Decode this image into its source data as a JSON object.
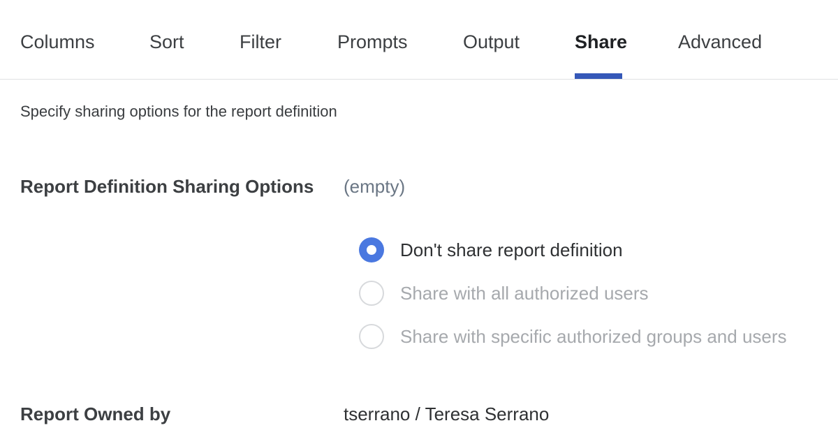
{
  "tabs": [
    {
      "label": "Columns"
    },
    {
      "label": "Sort"
    },
    {
      "label": "Filter"
    },
    {
      "label": "Prompts"
    },
    {
      "label": "Output"
    },
    {
      "label": "Share"
    },
    {
      "label": "Advanced"
    }
  ],
  "active_tab": "Share",
  "description": "Specify sharing options for the report definition",
  "sharing": {
    "label": "Report Definition Sharing Options",
    "current_value": "(empty)",
    "options": [
      {
        "label": "Don't share report definition",
        "selected": true
      },
      {
        "label": "Share with all authorized users",
        "selected": false
      },
      {
        "label": "Share with specific authorized groups and users",
        "selected": false
      }
    ]
  },
  "owner": {
    "label": "Report Owned by",
    "value": "tserrano / Teresa Serrano"
  },
  "colors": {
    "accent": "#3558b8",
    "radio_selected": "#4a78e0"
  }
}
